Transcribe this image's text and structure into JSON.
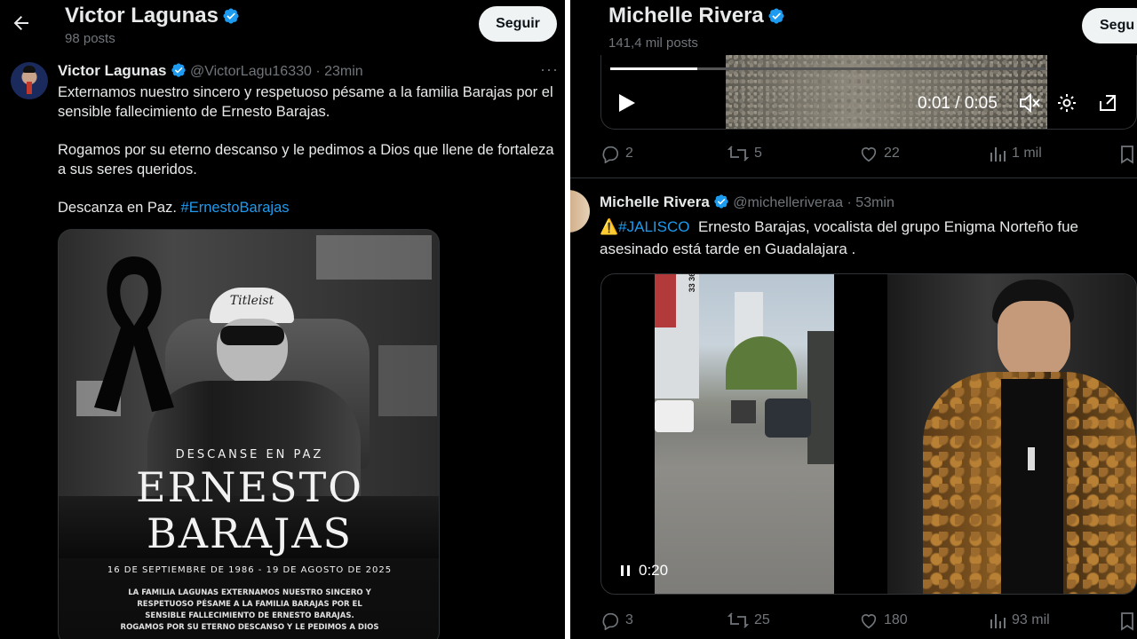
{
  "left": {
    "header": {
      "name": "Victor Lagunas",
      "posts": "98 posts",
      "follow_label": "Seguir"
    },
    "tweet": {
      "name": "Victor Lagunas",
      "handle": "@VictorLagu16330",
      "time": "· 23min",
      "lines": [
        "Externamos nuestro sincero y respetuoso pésame a la familia Barajas por el",
        "sensible fallecimiento de Ernesto Barajas.",
        "Rogamos por su eterno descanso y le pedimos a Dios que llene de fortaleza",
        "a sus seres queridos."
      ],
      "closing": "Descanza en Paz.",
      "hashtag": "#ErnestoBarajas",
      "image": {
        "cap_text": "Titleist",
        "rip": "DESCANSE EN PAZ",
        "first_name": "ERNESTO",
        "last_name": "BARAJAS",
        "dates": "16 DE SEPTIEMBRE DE 1986 - 19 DE AGOSTO DE 2025",
        "message": [
          "LA FAMILIA LAGUNAS EXTERNAMOS NUESTRO SINCERO Y",
          "RESPETUOSO PÉSAME A LA FAMILIA BARAJAS POR EL",
          "SENSIBLE FALLECIMIENTO DE ERNESTO BARAJAS.",
          "ROGAMOS POR SU ETERNO DESCANSO Y LE PEDIMOS A DIOS"
        ]
      }
    }
  },
  "right": {
    "header": {
      "name": "Michelle Rivera",
      "posts": "141,4 mil posts",
      "follow_label": "Segu"
    },
    "top_video": {
      "time": "0:01 / 0:05",
      "progress": 0.2
    },
    "top_actions": {
      "replies": "2",
      "reposts": "5",
      "likes": "22",
      "views": "1 mil"
    },
    "tweet": {
      "name": "Michelle Rivera",
      "handle": "@michelleriveraa",
      "time": "· 53min",
      "warning_icon": "⚠️",
      "hashtag": "#JALISCO",
      "line1": "Ernesto Barajas, vocalista del grupo Enigma Norteño fue",
      "line2": "asesinado está tarde en Guadalajara .",
      "video_time": "0:20",
      "sign_text": "33 36"
    },
    "bottom_actions": {
      "replies": "3",
      "reposts": "25",
      "likes": "180",
      "views": "93 mil"
    }
  },
  "colors": {
    "accent": "#1d9bf0",
    "muted": "#71767b",
    "text": "#e7e9ea",
    "button_bg": "#eff3f4"
  }
}
